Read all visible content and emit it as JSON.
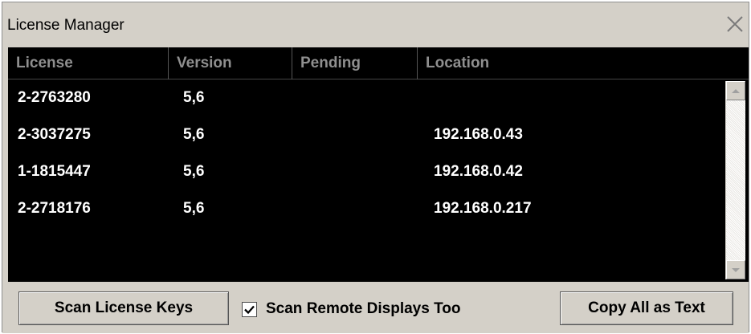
{
  "window": {
    "title": "License Manager"
  },
  "table": {
    "columns": [
      "License",
      "Version",
      "Pending",
      "Location"
    ],
    "rows": [
      {
        "license": "2-2763280",
        "version": "5,6",
        "pending": "",
        "location": ""
      },
      {
        "license": "2-3037275",
        "version": "5,6",
        "pending": "",
        "location": "192.168.0.43"
      },
      {
        "license": "1-1815447",
        "version": "5,6",
        "pending": "",
        "location": "192.168.0.42"
      },
      {
        "license": "2-2718176",
        "version": "5,6",
        "pending": "",
        "location": "192.168.0.217"
      }
    ]
  },
  "footer": {
    "scan_button": "Scan License Keys",
    "remote_checkbox_label": "Scan Remote Displays Too",
    "remote_checkbox_checked": true,
    "copy_button": "Copy All as Text"
  },
  "icons": {
    "close": "close-icon",
    "scroll_up": "arrow-up-icon",
    "scroll_down": "arrow-down-icon",
    "check": "checkmark-icon"
  },
  "colors": {
    "table_background": "#000000",
    "table_text": "#ffffff",
    "header_text": "#8f8f8f",
    "window_background": "#d4d0c8"
  }
}
